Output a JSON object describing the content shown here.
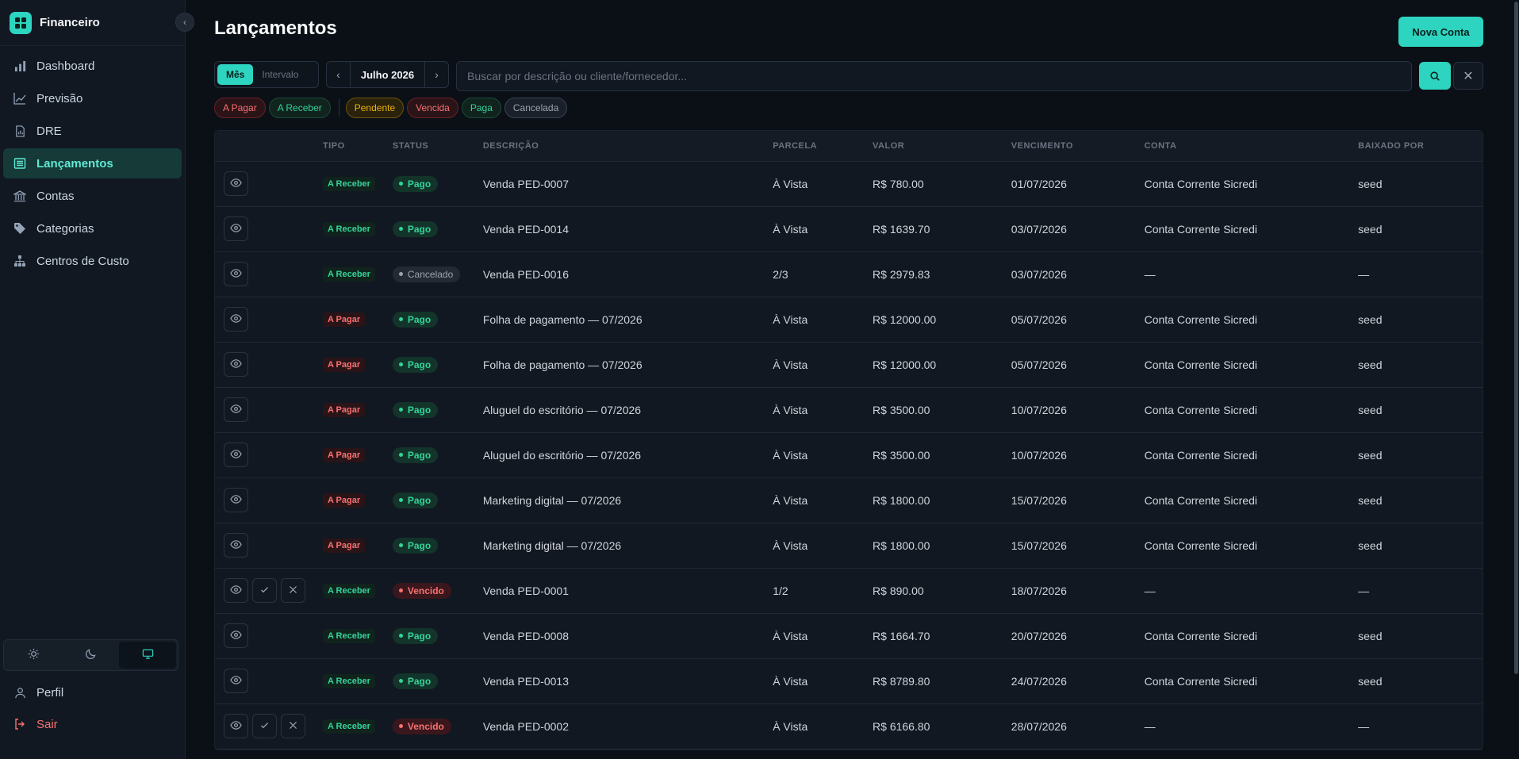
{
  "app": {
    "name": "Financeiro",
    "colors": {
      "accent": "#2dd4bf",
      "background": "#0b1017",
      "sidebar": "#111821",
      "danger": "#f87171",
      "success": "#34d399",
      "warning": "#eab308"
    }
  },
  "sidebar": {
    "collapse_icon": "chevron-left-icon",
    "items": [
      {
        "label": "Dashboard",
        "icon": "bar-chart-icon",
        "active": false
      },
      {
        "label": "Previsão",
        "icon": "trend-line-icon",
        "active": false
      },
      {
        "label": "DRE",
        "icon": "report-icon",
        "active": false
      },
      {
        "label": "Lançamentos",
        "icon": "list-icon",
        "active": true
      },
      {
        "label": "Contas",
        "icon": "bank-icon",
        "active": false
      },
      {
        "label": "Categorias",
        "icon": "tag-icon",
        "active": false
      },
      {
        "label": "Centros de Custo",
        "icon": "hierarchy-icon",
        "active": false
      }
    ],
    "theme_options": [
      {
        "icon": "sun-icon",
        "active": false
      },
      {
        "icon": "moon-icon",
        "active": false
      },
      {
        "icon": "monitor-icon",
        "active": true
      }
    ],
    "profile_label": "Perfil",
    "logout_label": "Sair"
  },
  "header": {
    "title": "Lançamentos",
    "new_account_label": "Nova Conta"
  },
  "filters": {
    "mode_options": [
      "Mês",
      "Intervalo"
    ],
    "mode_selected": "Mês",
    "month_label": "Julho 2026",
    "search_placeholder": "Buscar por descrição ou cliente/fornecedor...",
    "type_chips": [
      "A Pagar",
      "A Receber"
    ],
    "status_chips": [
      "Pendente",
      "Vencida",
      "Paga",
      "Cancelada"
    ]
  },
  "table": {
    "columns": [
      "",
      "TIPO",
      "STATUS",
      "DESCRIÇÃO",
      "PARCELA",
      "VALOR",
      "VENCIMENTO",
      "CONTA",
      "BAIXADO POR"
    ],
    "rows": [
      {
        "actions": [
          "view"
        ],
        "tipo": "A Receber",
        "status": "Pago",
        "descricao": "Venda PED-0007",
        "parcela": "À Vista",
        "valor": "R$ 780.00",
        "vencimento": "01/07/2026",
        "conta": "Conta Corrente Sicredi",
        "baixado_por": "seed"
      },
      {
        "actions": [
          "view"
        ],
        "tipo": "A Receber",
        "status": "Pago",
        "descricao": "Venda PED-0014",
        "parcela": "À Vista",
        "valor": "R$ 1639.70",
        "vencimento": "03/07/2026",
        "conta": "Conta Corrente Sicredi",
        "baixado_por": "seed"
      },
      {
        "actions": [
          "view"
        ],
        "tipo": "A Receber",
        "status": "Cancelado",
        "descricao": "Venda PED-0016",
        "parcela": "2/3",
        "valor": "R$ 2979.83",
        "vencimento": "03/07/2026",
        "conta": "—",
        "baixado_por": "—"
      },
      {
        "actions": [
          "view"
        ],
        "tipo": "A Pagar",
        "status": "Pago",
        "descricao": "Folha de pagamento — 07/2026",
        "parcela": "À Vista",
        "valor": "R$ 12000.00",
        "vencimento": "05/07/2026",
        "conta": "Conta Corrente Sicredi",
        "baixado_por": "seed"
      },
      {
        "actions": [
          "view"
        ],
        "tipo": "A Pagar",
        "status": "Pago",
        "descricao": "Folha de pagamento — 07/2026",
        "parcela": "À Vista",
        "valor": "R$ 12000.00",
        "vencimento": "05/07/2026",
        "conta": "Conta Corrente Sicredi",
        "baixado_por": "seed"
      },
      {
        "actions": [
          "view"
        ],
        "tipo": "A Pagar",
        "status": "Pago",
        "descricao": "Aluguel do escritório — 07/2026",
        "parcela": "À Vista",
        "valor": "R$ 3500.00",
        "vencimento": "10/07/2026",
        "conta": "Conta Corrente Sicredi",
        "baixado_por": "seed"
      },
      {
        "actions": [
          "view"
        ],
        "tipo": "A Pagar",
        "status": "Pago",
        "descricao": "Aluguel do escritório — 07/2026",
        "parcela": "À Vista",
        "valor": "R$ 3500.00",
        "vencimento": "10/07/2026",
        "conta": "Conta Corrente Sicredi",
        "baixado_por": "seed"
      },
      {
        "actions": [
          "view"
        ],
        "tipo": "A Pagar",
        "status": "Pago",
        "descricao": "Marketing digital — 07/2026",
        "parcela": "À Vista",
        "valor": "R$ 1800.00",
        "vencimento": "15/07/2026",
        "conta": "Conta Corrente Sicredi",
        "baixado_por": "seed"
      },
      {
        "actions": [
          "view"
        ],
        "tipo": "A Pagar",
        "status": "Pago",
        "descricao": "Marketing digital — 07/2026",
        "parcela": "À Vista",
        "valor": "R$ 1800.00",
        "vencimento": "15/07/2026",
        "conta": "Conta Corrente Sicredi",
        "baixado_por": "seed"
      },
      {
        "actions": [
          "view",
          "settle",
          "cancel"
        ],
        "tipo": "A Receber",
        "status": "Vencido",
        "descricao": "Venda PED-0001",
        "parcela": "1/2",
        "valor": "R$ 890.00",
        "vencimento": "18/07/2026",
        "conta": "—",
        "baixado_por": "—"
      },
      {
        "actions": [
          "view"
        ],
        "tipo": "A Receber",
        "status": "Pago",
        "descricao": "Venda PED-0008",
        "parcela": "À Vista",
        "valor": "R$ 1664.70",
        "vencimento": "20/07/2026",
        "conta": "Conta Corrente Sicredi",
        "baixado_por": "seed"
      },
      {
        "actions": [
          "view"
        ],
        "tipo": "A Receber",
        "status": "Pago",
        "descricao": "Venda PED-0013",
        "parcela": "À Vista",
        "valor": "R$ 8789.80",
        "vencimento": "24/07/2026",
        "conta": "Conta Corrente Sicredi",
        "baixado_por": "seed"
      },
      {
        "actions": [
          "view",
          "settle",
          "cancel"
        ],
        "tipo": "A Receber",
        "status": "Vencido",
        "descricao": "Venda PED-0002",
        "parcela": "À Vista",
        "valor": "R$ 6166.80",
        "vencimento": "28/07/2026",
        "conta": "—",
        "baixado_por": "—"
      }
    ]
  }
}
